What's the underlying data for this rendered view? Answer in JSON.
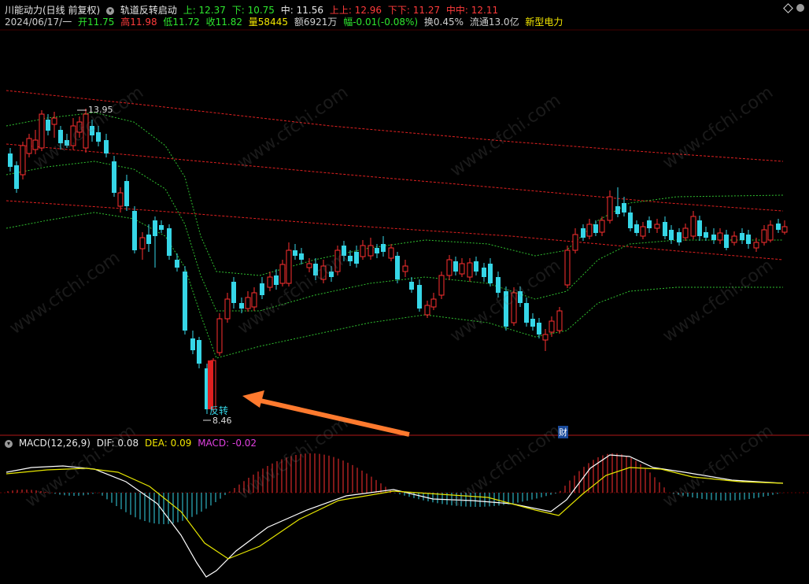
{
  "header": {
    "stock_title": "川能动力(日线 前复权)",
    "indicator_name": "轨道反转启动",
    "shang": "上: 12.37",
    "xia": "下: 10.75",
    "zhong": "中: 11.56",
    "shangshang": "上上: 12.96",
    "xiaxia": "下下: 11.27",
    "zhongzhong": "中中: 12.11",
    "date": "2024/06/17/一",
    "open": "开11.75",
    "high": "高11.98",
    "low": "低11.72",
    "close": "收11.82",
    "volume": "量58445",
    "amount": "额6921万",
    "change": "幅-0.01(-0.08%)",
    "turnover": "换0.45%",
    "float_cap": "流通13.0亿",
    "sector": "新型电力"
  },
  "annotations": {
    "high_mark": "13.95",
    "low_mark": "8.46",
    "reversal_label": "反转",
    "finance_badge": "财"
  },
  "macd": {
    "title": "MACD(12,26,9)",
    "dif": "DIF: 0.08",
    "dea": "DEA: 0.09",
    "macd": "MACD: -0.02"
  },
  "watermark": "www.cfchi.com",
  "colors": {
    "up": "#ff3030",
    "down": "#36d6e7",
    "dif": "#ffffff",
    "dea": "#e6e600",
    "upper_band": "#ff3030",
    "lower_band": "#22cc22",
    "arrow": "#ff7a2e"
  }
}
